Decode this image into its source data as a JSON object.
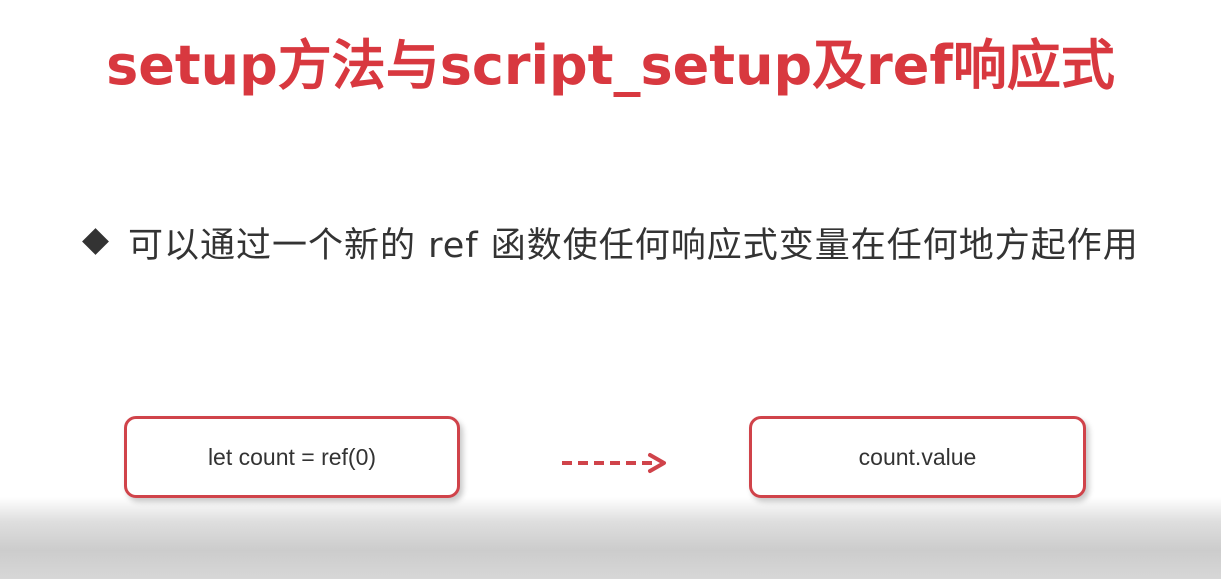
{
  "slide": {
    "title": "setup方法与script_setup及ref响应式",
    "bullet": {
      "text": "可以通过一个新的 ref 函数使任何响应式变量在任何地方起作用"
    },
    "diagram": {
      "left_box": "let count = ref(0)",
      "right_box": "count.value",
      "arrow_style": "dashed"
    }
  },
  "colors": {
    "title": "#d8383f",
    "box_border": "#d0434a",
    "arrow": "#d0434a",
    "body_text": "#333333"
  },
  "icons": {
    "bullet": "diamond-bullet-icon",
    "arrow": "dashed-arrow-right-icon"
  }
}
